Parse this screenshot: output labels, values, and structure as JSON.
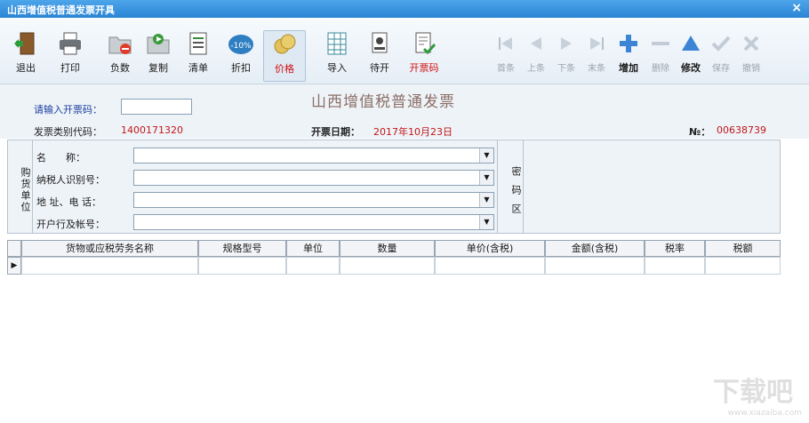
{
  "window": {
    "title": "山西增值税普通发票开具",
    "close_symbol": "×"
  },
  "toolbar": {
    "exit": "退出",
    "print": "打印",
    "negative": "负数",
    "copy": "复制",
    "list": "清单",
    "discount": "折扣",
    "price": "价格",
    "import": "导入",
    "pending": "待开",
    "invoice_code_btn": "开票码",
    "first": "首条",
    "prev": "上条",
    "next": "下条",
    "last": "末条",
    "add": "增加",
    "delete": "删除",
    "modify": "修改",
    "save": "保存",
    "cancel": "撤销",
    "discount_badge": "-10%"
  },
  "header": {
    "invoice_title": "山西增值税普通发票",
    "code_prompt": "请输入开票码：",
    "code_value": "",
    "type_code_label": "发票类别代码：",
    "type_code": "1400171320",
    "date_label": "开票日期：",
    "date": "2017年10月23日",
    "no_label": "№：",
    "no": "00638739"
  },
  "buyer": {
    "section_label": "购货单位",
    "name_label": "名　　称：",
    "taxid_label": "纳税人识别号：",
    "address_label": "地 址、电 话：",
    "bank_label": "开户行及帐号：",
    "name": "",
    "taxid": "",
    "address": "",
    "bank": "",
    "cipher_label": "密码区"
  },
  "grid": {
    "columns": [
      "货物或应税劳务名称",
      "规格型号",
      "单位",
      "数量",
      "单价(含税)",
      "金额(含税)",
      "税率",
      "税额"
    ],
    "row_indicator": "▶"
  },
  "watermark": {
    "main": "下载吧",
    "sub": "www.xiazaiba.com"
  }
}
